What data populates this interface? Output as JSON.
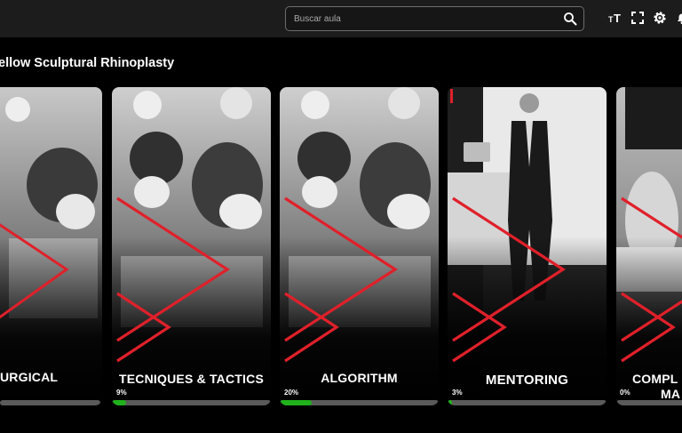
{
  "header": {
    "search_placeholder": "Buscar aula",
    "icons": [
      "search-icon",
      "text-size-icon",
      "fullscreen-icon",
      "settings-icon",
      "notification-icon"
    ]
  },
  "course": {
    "title": "ellow Sculptural Rhinoplasty"
  },
  "colors": {
    "accent": "#e0202a",
    "progress": "#20b11c",
    "track": "#5a5a5a",
    "topbar": "#1c1c1c"
  },
  "modules": [
    {
      "label": "URGICAL",
      "progress_text": "",
      "progress": 0
    },
    {
      "label": "TECNIQUES & TACTICS",
      "progress_text": "9%",
      "progress": 0.09
    },
    {
      "label": "ALGORITHM",
      "progress_text": "20%",
      "progress": 0.2
    },
    {
      "label": "MENTORING",
      "progress_text": "3%",
      "progress": 0.03
    },
    {
      "label": "COMPL",
      "label2": "MA",
      "progress_text": "0%",
      "progress": 0
    }
  ]
}
